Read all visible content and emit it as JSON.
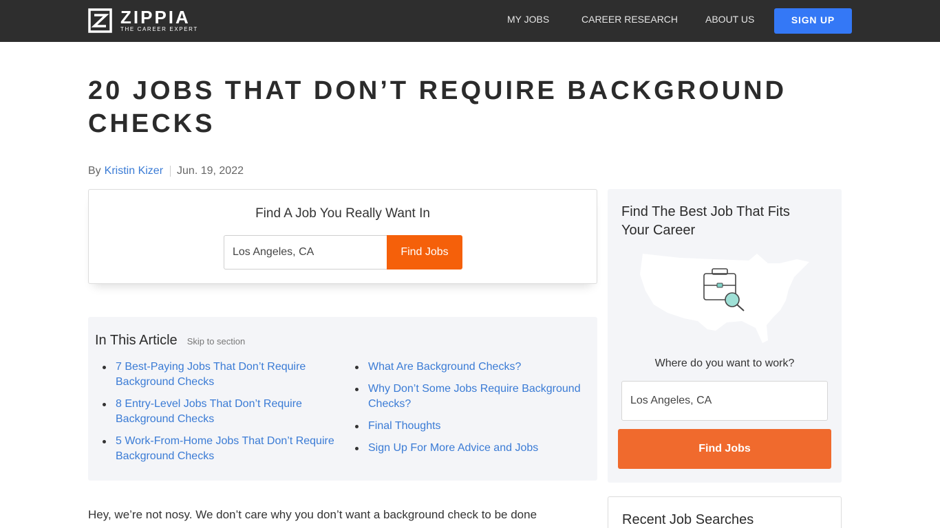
{
  "brand": {
    "name": "ZIPPIA",
    "tagline": "THE CAREER EXPERT"
  },
  "nav": {
    "my_jobs": "MY JOBS",
    "career_research": "CAREER RESEARCH",
    "about_us": "ABOUT US",
    "sign_up": "SIGN UP"
  },
  "article": {
    "title": "20 JOBS THAT DON’T REQUIRE BACKGROUND CHECKS",
    "by_label": "By",
    "author": "Kristin Kizer",
    "date": "Jun. 19, 2022",
    "intro": "Hey, we’re not nosy. We don’t care why you don’t want a background check to be done"
  },
  "job_search": {
    "heading": "Find A Job You Really Want In",
    "location_value": "Los Angeles, CA",
    "button": "Find Jobs"
  },
  "toc": {
    "heading": "In This Article",
    "skip": "Skip to section",
    "col1": [
      "7 Best-Paying Jobs That Don’t Require Background Checks",
      "8 Entry-Level Jobs That Don’t Require Background Checks",
      "5 Work-From-Home Jobs That Don’t Require Background Checks"
    ],
    "col2": [
      "What Are Background Checks?",
      "Why Don’t Some Jobs Require Background Checks?",
      "Final Thoughts",
      "Sign Up For More Advice and Jobs"
    ]
  },
  "sidebar": {
    "heading": "Find The Best Job That Fits Your Career",
    "where_label": "Where do you want to work?",
    "location_value": "Los Angeles, CA",
    "button": "Find Jobs",
    "recent_heading": "Recent Job Searches",
    "illustration_icons": [
      "us-map-icon",
      "briefcase-icon",
      "magnifier-icon"
    ]
  },
  "colors": {
    "topbar": "#2e2e2e",
    "signup": "#3478f6",
    "find_jobs_orange": "#f5600a",
    "sidebar_button": "#f06a2d",
    "link": "#3a7bd5",
    "panel_bg": "#f4f5f8"
  }
}
